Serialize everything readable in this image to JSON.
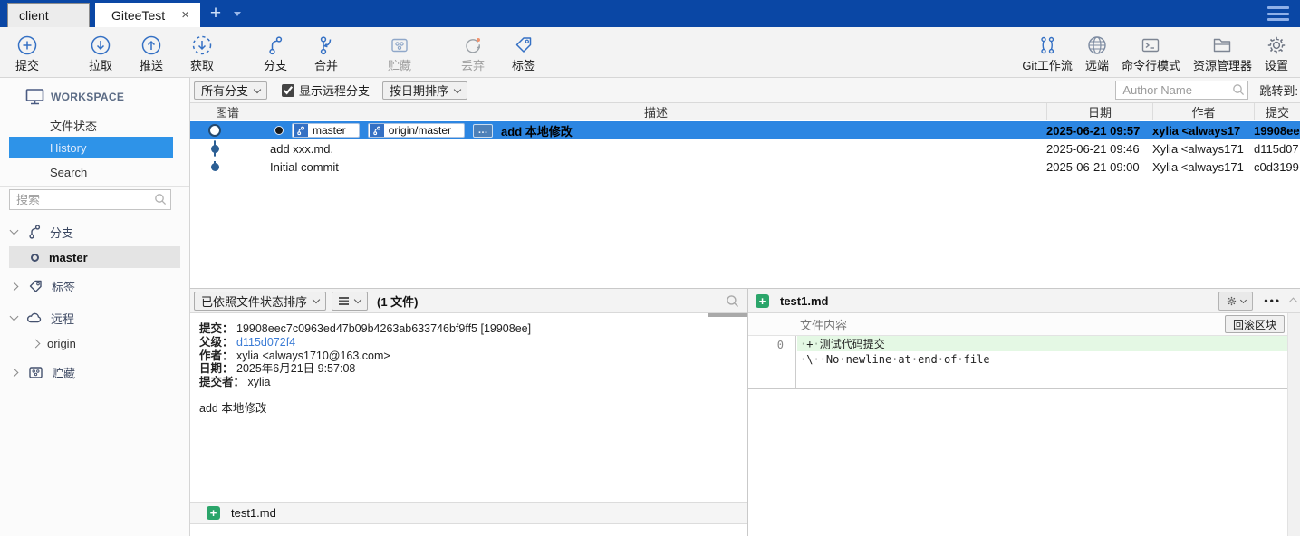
{
  "colors": {
    "titlebar_blue": "#0a47a5",
    "selection_blue": "#2c86e2",
    "sidebar_selection_blue": "#2e93e8",
    "icon_blue": "#3470c4",
    "link_blue": "#3a7bd5",
    "added_green": "#2ba56a",
    "diff_add_bg": "#e4f8e4",
    "discard_warn_dot": "#f0926e"
  },
  "tab_bar": {
    "tabs": [
      {
        "label": "client"
      },
      {
        "label": "GiteeTest"
      }
    ],
    "close_glyph": "×",
    "new_tab_glyph": "+"
  },
  "toolbar": {
    "items": [
      {
        "label": "提交"
      },
      {
        "label": "拉取"
      },
      {
        "label": "推送"
      },
      {
        "label": "获取"
      },
      {
        "label": "分支"
      },
      {
        "label": "合并"
      },
      {
        "label": "贮藏",
        "disabled": true
      },
      {
        "label": "丢弃",
        "disabled": true
      },
      {
        "label": "标签"
      }
    ],
    "right_items": [
      {
        "label": "Git工作流"
      },
      {
        "label": "远端"
      },
      {
        "label": "命令行模式"
      },
      {
        "label": "资源管理器"
      },
      {
        "label": "设置"
      }
    ]
  },
  "sidebar": {
    "workspace_label": "WORKSPACE",
    "nav": [
      {
        "label": "文件状态"
      },
      {
        "label": "History",
        "selected": true
      },
      {
        "label": "Search"
      }
    ],
    "search_placeholder": "搜索",
    "tree": {
      "branches_label": "分支",
      "branch_items": [
        {
          "label": "master",
          "selected": true
        }
      ],
      "tags_label": "标签",
      "remotes_label": "远程",
      "remote_items": [
        {
          "label": "origin"
        }
      ],
      "stash_label": "贮藏"
    }
  },
  "history": {
    "branch_filter": "所有分支",
    "show_remote_label": "显示远程分支",
    "show_remote_checked": "checked",
    "sort_label": "按日期排序",
    "author_placeholder": "Author Name",
    "jump_label": "跳转到:",
    "columns": [
      "图谱",
      "描述",
      "日期",
      "作者",
      "提交"
    ],
    "commits": [
      {
        "message": "add 本地修改",
        "refs": [
          "master",
          "origin/master"
        ],
        "more_ref": "…",
        "date": "2025-06-21 09:57",
        "author": "xylia <always17",
        "hash": "19908ee",
        "selected": true
      },
      {
        "message": "add xxx.md.",
        "date": "2025-06-21 09:46",
        "author": "Xylia <always171",
        "hash": "d115d07"
      },
      {
        "message": "Initial commit",
        "date": "2025-06-21 09:00",
        "author": "Xylia <always171",
        "hash": "c0d3199"
      }
    ]
  },
  "file_panel": {
    "sort_selected": "已依照文件状态排序",
    "count_label": "(1 文件)",
    "added_icon_glyph": "+",
    "details": {
      "commit_label": "提交：",
      "commit_value": "19908eec7c0963ed47b09b4263ab633746bf9ff5 [19908ee]",
      "parent_label": "父级：",
      "parent_value": "d115d072f4",
      "author_label": "作者：",
      "author_value": "xylia <always1710@163.com>",
      "date_label": "日期：",
      "date_value": "2025年6月21日 9:57:08",
      "committer_label": "提交者：",
      "committer_value": "xylia",
      "message": "add 本地修改"
    },
    "files": [
      {
        "name": "test1.md",
        "status": "added"
      }
    ]
  },
  "diff_panel": {
    "file_name": "test1.md",
    "content_label": "文件内容",
    "rollback_button": "回滚区块",
    "more_button": "•••",
    "lines": [
      {
        "lineno": "0",
        "dot_before": "·",
        "sign": "+",
        "dot_after": "·",
        "text": "测试代码提交",
        "added": true
      },
      {
        "lineno": "",
        "dot_before": "·",
        "sign": "\\",
        "dot_after": "··",
        "text": "No·newline·at·end·of·file",
        "added": false
      }
    ]
  }
}
